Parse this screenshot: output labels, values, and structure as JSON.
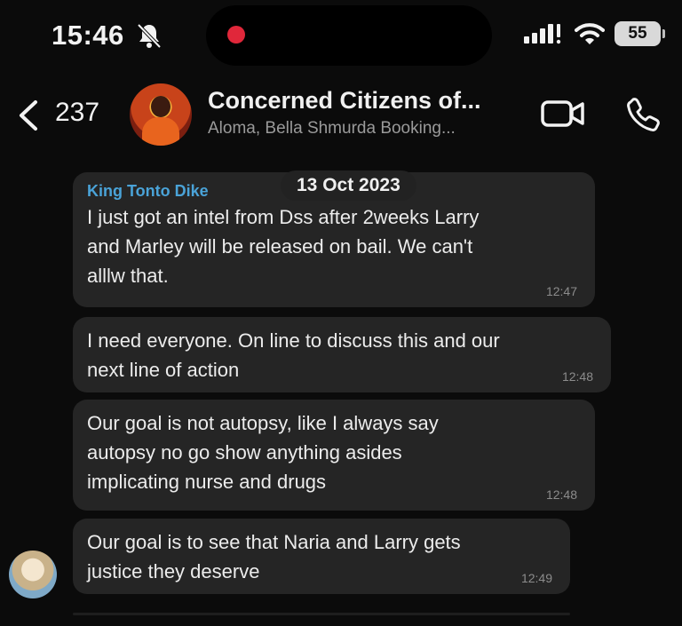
{
  "status_bar": {
    "time": "15:46",
    "battery": "55"
  },
  "header": {
    "back_count": "237",
    "group_name": "Concerned Citizens of...",
    "members": "Aloma, Bella Shmurda Booking..."
  },
  "chat": {
    "date": "13 Oct 2023",
    "messages": [
      {
        "sender": "King Tonto Dike",
        "text": "I just got an intel from Dss after 2weeks Larry\nand Marley will be released on bail. We can't\nalllw that.",
        "time": "12:47"
      },
      {
        "text": "I need everyone. On line to discuss this and our\nnext line of action",
        "time": "12:48"
      },
      {
        "text": "Our goal is not autopsy, like I always say\nautopsy no go show anything asides\nimplicating nurse and drugs",
        "time": "12:48"
      },
      {
        "text": "Our goal is to see that Naria and Larry gets\njustice they deserve",
        "time": "12:49"
      }
    ]
  },
  "colors": {
    "background": "#0b0b0b",
    "bubble": "#252525",
    "sender_name": "#4aa3d8",
    "record_dot": "#e0273a"
  }
}
